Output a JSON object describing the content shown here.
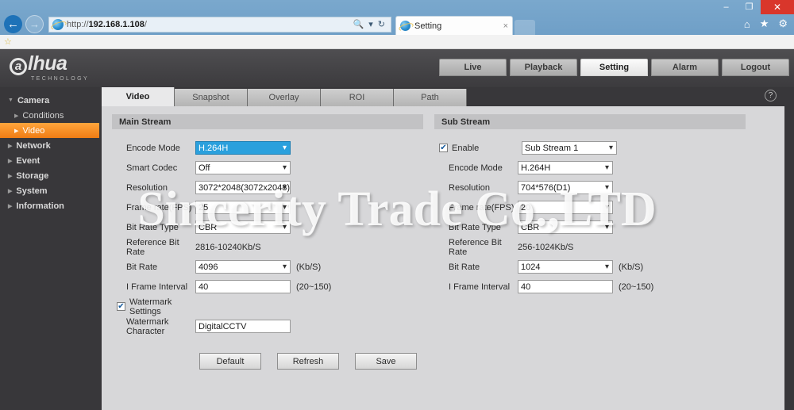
{
  "browser": {
    "url_scheme": "http://",
    "url_host": "192.168.1.108",
    "url_path": "/",
    "search_icon": "search-icon",
    "dropdown_icon": "chevron-down-icon",
    "refresh_icon": "refresh-icon",
    "tab_title": "Setting",
    "tab_close": "×",
    "minimize": "–",
    "maximize": "❐",
    "close": "✕",
    "home_icon": "⌂",
    "favorites_icon": "★",
    "tools_icon": "⚙",
    "fav_bar_icon": "☆",
    "back_icon": "←",
    "forward_icon": "→"
  },
  "header": {
    "logo_mark": "a",
    "logo_text": "lhua",
    "logo_sub": "TECHNOLOGY",
    "nav": [
      {
        "label": "Live",
        "active": false
      },
      {
        "label": "Playback",
        "active": false
      },
      {
        "label": "Setting",
        "active": true
      },
      {
        "label": "Alarm",
        "active": false
      },
      {
        "label": "Logout",
        "active": false
      }
    ]
  },
  "sidebar": {
    "items": [
      {
        "label": "Camera",
        "level": 0,
        "expanded": true,
        "active": false
      },
      {
        "label": "Conditions",
        "level": 1,
        "expanded": false,
        "active": false
      },
      {
        "label": "Video",
        "level": 1,
        "expanded": false,
        "active": true
      },
      {
        "label": "Network",
        "level": 0,
        "expanded": false,
        "active": false
      },
      {
        "label": "Event",
        "level": 0,
        "expanded": false,
        "active": false
      },
      {
        "label": "Storage",
        "level": 0,
        "expanded": false,
        "active": false
      },
      {
        "label": "System",
        "level": 0,
        "expanded": false,
        "active": false
      },
      {
        "label": "Information",
        "level": 0,
        "expanded": false,
        "active": false
      }
    ]
  },
  "tabs": [
    {
      "label": "Video",
      "active": true
    },
    {
      "label": "Snapshot",
      "active": false
    },
    {
      "label": "Overlay",
      "active": false
    },
    {
      "label": "ROI",
      "active": false
    },
    {
      "label": "Path",
      "active": false
    }
  ],
  "help_icon": "?",
  "main_stream": {
    "title": "Main Stream",
    "encode_mode_label": "Encode Mode",
    "encode_mode_value": "H.264H",
    "smart_codec_label": "Smart Codec",
    "smart_codec_value": "Off",
    "resolution_label": "Resolution",
    "resolution_value": "3072*2048(3072x2048)",
    "frame_rate_label": "Frame rate(FPS)",
    "frame_rate_value": "25",
    "bit_rate_type_label": "Bit Rate Type",
    "bit_rate_type_value": "CBR",
    "ref_bit_rate_label": "Reference Bit Rate",
    "ref_bit_rate_value": "2816-10240Kb/S",
    "bit_rate_label": "Bit Rate",
    "bit_rate_value": "4096",
    "bit_rate_unit": "(Kb/S)",
    "i_frame_label": "I Frame Interval",
    "i_frame_value": "40",
    "i_frame_range": "(20~150)",
    "watermark_settings_label": "Watermark Settings",
    "watermark_checked": "✔",
    "watermark_char_label": "Watermark Character",
    "watermark_char_value": "DigitalCCTV"
  },
  "sub_stream": {
    "title": "Sub Stream",
    "enable_label": "Enable",
    "enable_checked": "✔",
    "stream_value": "Sub Stream 1",
    "encode_mode_label": "Encode Mode",
    "encode_mode_value": "H.264H",
    "resolution_label": "Resolution",
    "resolution_value": "704*576(D1)",
    "frame_rate_label": "Frame rate(FPS)",
    "frame_rate_value": "20",
    "bit_rate_type_label": "Bit Rate Type",
    "bit_rate_type_value": "CBR",
    "ref_bit_rate_label": "Reference Bit Rate",
    "ref_bit_rate_value": "256-1024Kb/S",
    "bit_rate_label": "Bit Rate",
    "bit_rate_value": "1024",
    "bit_rate_unit": "(Kb/S)",
    "i_frame_label": "I Frame Interval",
    "i_frame_value": "40",
    "i_frame_range": "(20~150)"
  },
  "buttons": {
    "default": "Default",
    "refresh": "Refresh",
    "save": "Save"
  },
  "overlay_watermark": "Sincerity Trade Co.,LTD",
  "colors": {
    "accent_orange": "#f58220",
    "select_focus_blue": "#2aa0dd",
    "panel_bg": "#d7d7d9",
    "dark_bg": "#38373a"
  }
}
